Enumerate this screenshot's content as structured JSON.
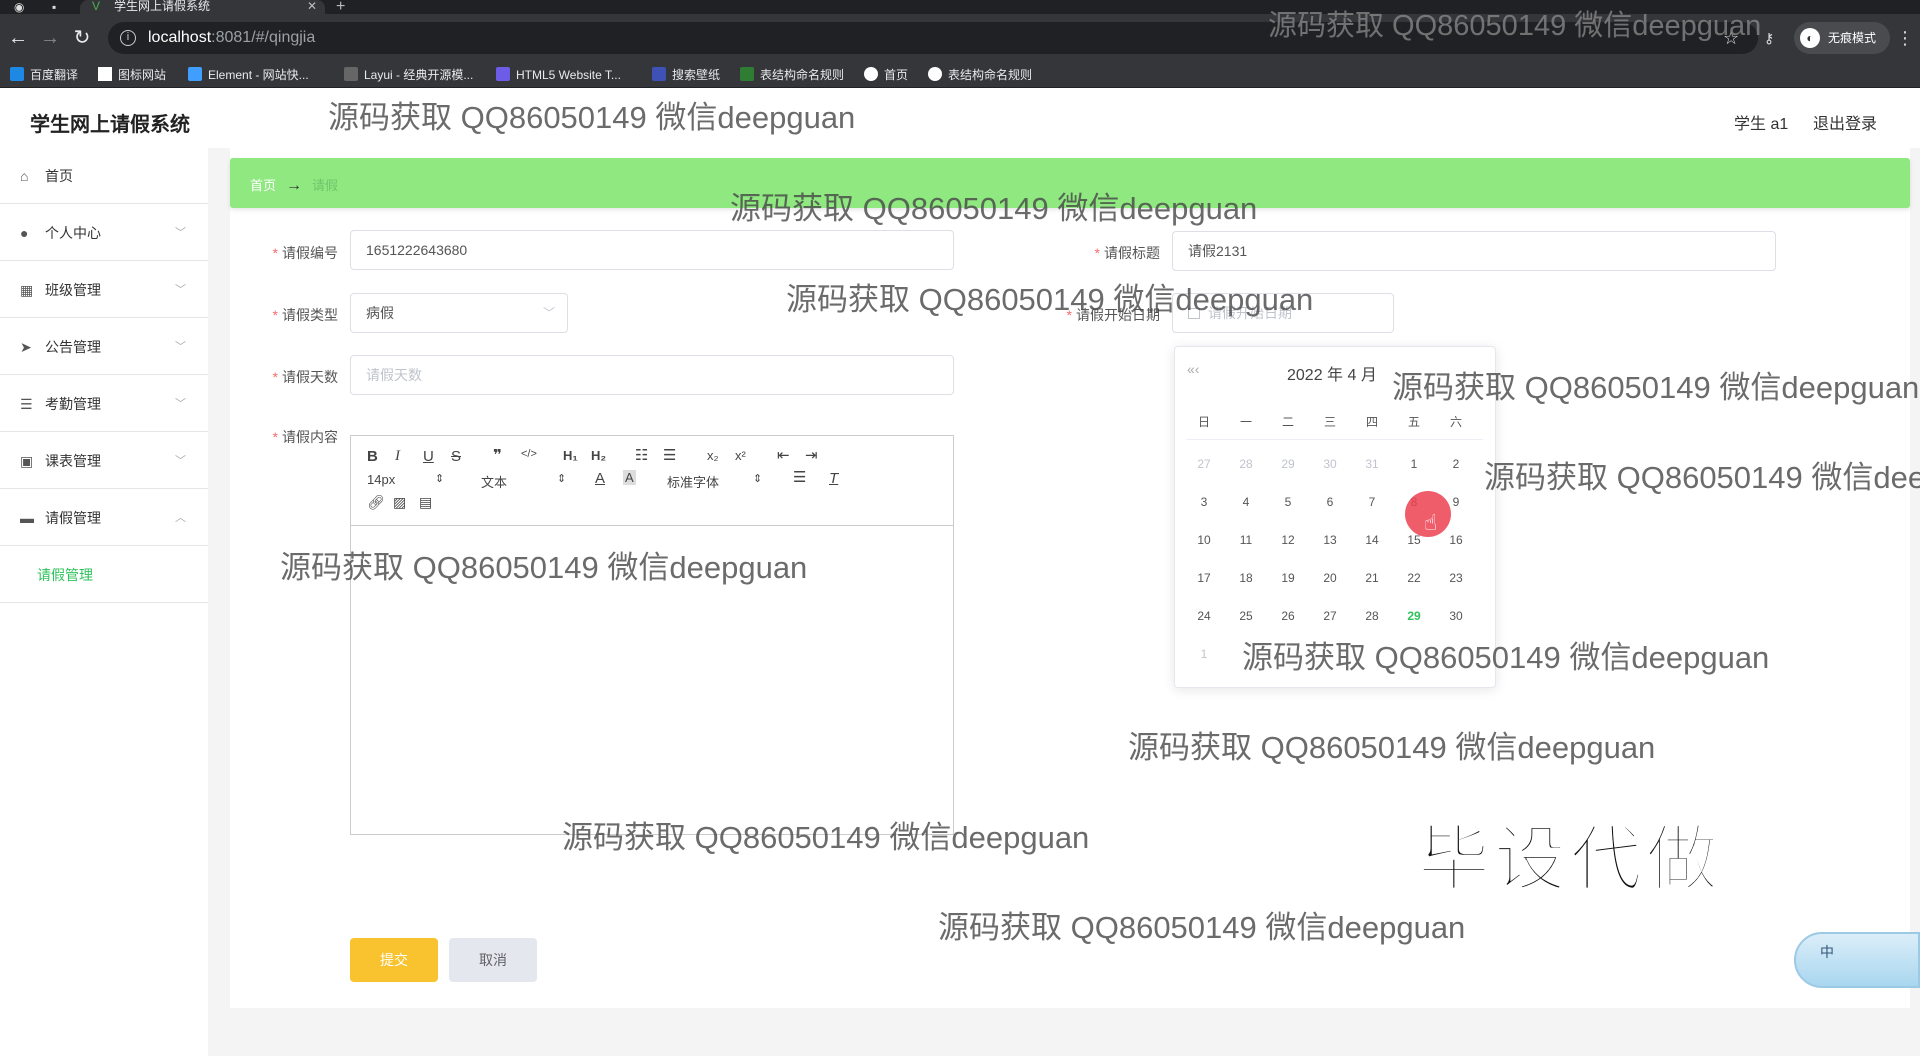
{
  "browser": {
    "tab_title": "学生网上请假系统",
    "url_host": "localhost",
    "url_path": ":8081/#/qingjia",
    "incognito_label": "无痕模式",
    "bookmarks": [
      "百度翻译",
      "图标网站",
      "Element - 网站快...",
      "Layui - 经典开源模...",
      "HTML5 Website T...",
      "搜索壁纸",
      "表结构命名规则",
      "首页",
      "表结构命名规则"
    ]
  },
  "app": {
    "title": "学生网上请假系统",
    "user": "学生 a1",
    "logout": "退出登录"
  },
  "sidebar": {
    "items": [
      {
        "label": "首页"
      },
      {
        "label": "个人中心"
      },
      {
        "label": "班级管理"
      },
      {
        "label": "公告管理"
      },
      {
        "label": "考勤管理"
      },
      {
        "label": "课表管理"
      },
      {
        "label": "请假管理"
      }
    ],
    "sub_item": "请假管理"
  },
  "breadcrumb": {
    "home": "首页",
    "arrow": "→",
    "current": "请假"
  },
  "form": {
    "leave_no_label": "请假编号",
    "leave_no_value": "1651222643680",
    "leave_title_label": "请假标题",
    "leave_title_value": "请假2131",
    "leave_type_label": "请假类型",
    "leave_type_value": "病假",
    "start_date_label": "请假开始日期",
    "start_date_placeholder": "请假开始日期",
    "days_label": "请假天数",
    "days_placeholder": "请假天数",
    "content_label": "请假内容",
    "required_mark": "*"
  },
  "editor": {
    "font_size": "14px",
    "text_style": "文本",
    "font_family": "标准字体"
  },
  "datepicker": {
    "prev": "«‹",
    "title": "2022 年  4 月",
    "weekdays": [
      "日",
      "一",
      "二",
      "三",
      "四",
      "五",
      "六"
    ],
    "rows": [
      [
        "27",
        "28",
        "29",
        "30",
        "31",
        "1",
        "2"
      ],
      [
        "3",
        "4",
        "5",
        "6",
        "7",
        "8",
        "9"
      ],
      [
        "10",
        "11",
        "12",
        "13",
        "14",
        "15",
        "16"
      ],
      [
        "17",
        "18",
        "19",
        "20",
        "21",
        "22",
        "23"
      ],
      [
        "24",
        "25",
        "26",
        "27",
        "28",
        "29",
        "30"
      ],
      [
        "1",
        "",
        "",
        "",
        "",
        "",
        ""
      ]
    ],
    "today": "29"
  },
  "buttons": {
    "submit": "提交",
    "cancel": "取消"
  },
  "overlays": {
    "watermark": "源码获取 QQ86050149 微信deepguan",
    "big_text": "毕设代做",
    "ime_label": "中"
  },
  "colors": {
    "breadcrumb_bg": "#8fe880",
    "accent_green": "#2fc25b",
    "submit_yellow": "#f8c32f",
    "required_red": "#f56c6c"
  }
}
